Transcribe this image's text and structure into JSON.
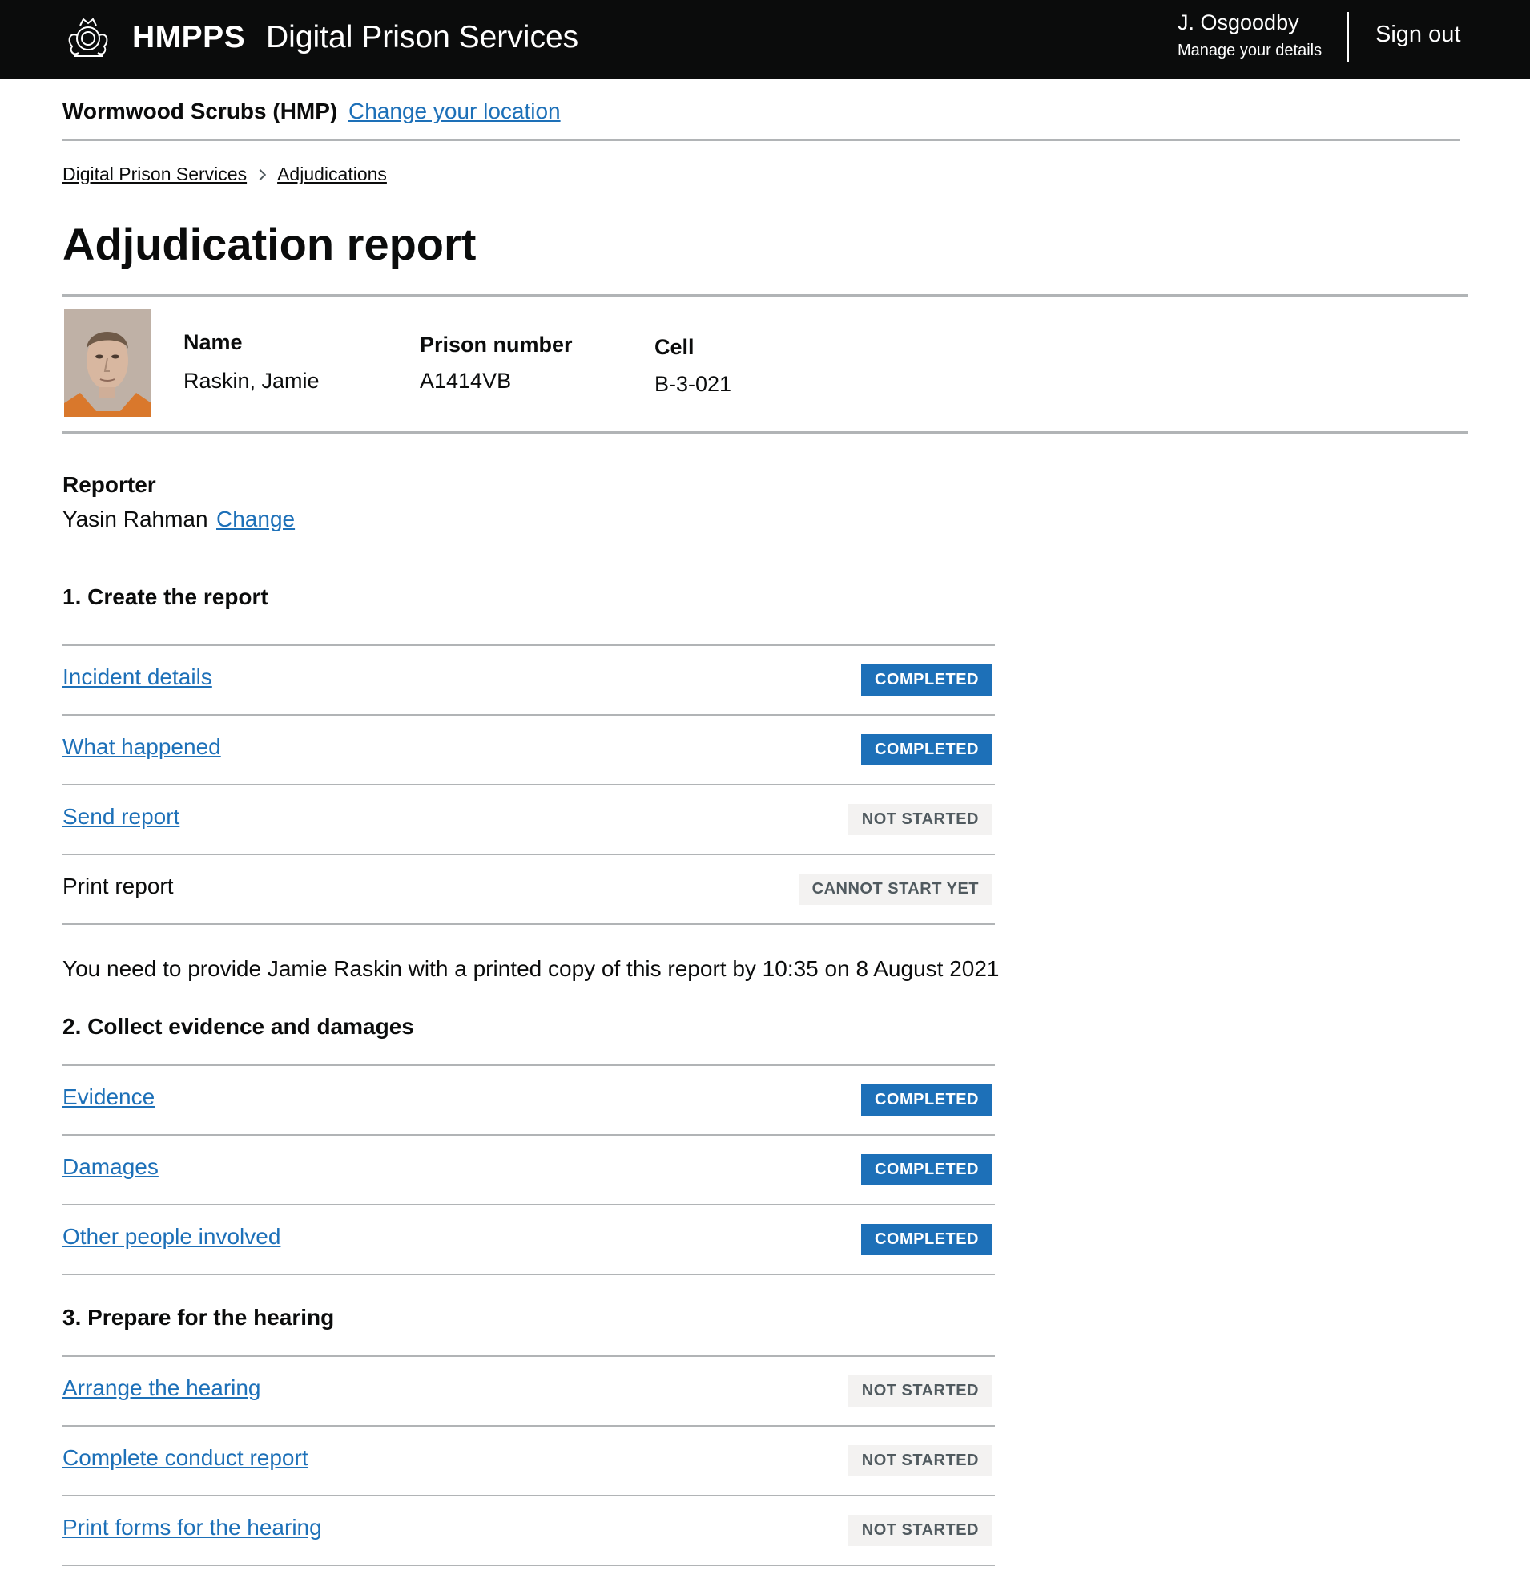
{
  "header": {
    "brand": "HMPPS",
    "service": "Digital Prison Services",
    "user_name": "J. Osgoodby",
    "manage_details": "Manage your details",
    "sign_out": "Sign out"
  },
  "location": {
    "name": "Wormwood Scrubs (HMP)",
    "change_label": "Change your location"
  },
  "breadcrumb": [
    "Digital Prison Services",
    "Adjudications"
  ],
  "page_title": "Adjudication report",
  "prisoner": {
    "name_label": "Name",
    "name": "Raskin, Jamie",
    "prison_number_label": "Prison number",
    "prison_number": "A1414VB",
    "cell_label": "Cell",
    "cell": "B-3-021"
  },
  "reporter": {
    "label": "Reporter",
    "name": "Yasin Rahman",
    "change_label": "Change"
  },
  "sections": [
    {
      "heading": "1. Create the report",
      "tasks": [
        {
          "name": "Incident details",
          "status": "COMPLETED"
        },
        {
          "name": "What happened",
          "status": "COMPLETED"
        },
        {
          "name": "Send report",
          "status": "NOT STARTED"
        },
        {
          "name": "Print report",
          "status": "CANNOT START YET"
        }
      ]
    },
    {
      "heading": "2. Collect evidence and damages",
      "tasks": [
        {
          "name": "Evidence",
          "status": "COMPLETED"
        },
        {
          "name": "Damages",
          "status": "COMPLETED"
        },
        {
          "name": "Other people involved",
          "status": "COMPLETED"
        }
      ]
    },
    {
      "heading": "3. Prepare for the hearing",
      "tasks": [
        {
          "name": "Arrange the hearing",
          "status": "NOT STARTED"
        },
        {
          "name": "Complete conduct report",
          "status": "NOT STARTED"
        },
        {
          "name": "Print forms for the hearing",
          "status": "NOT STARTED"
        }
      ]
    }
  ],
  "print_note": "You need to provide Jamie Raskin with a printed copy of this report by 10:35 on 8 August 2021",
  "colors": {
    "header_bg": "#0b0c0c",
    "link": "#1d70b8",
    "tag_completed_bg": "#1d70b8",
    "tag_grey_bg": "#f3f2f1",
    "tag_grey_text": "#505a5f",
    "rule": "#b1b4b6"
  }
}
